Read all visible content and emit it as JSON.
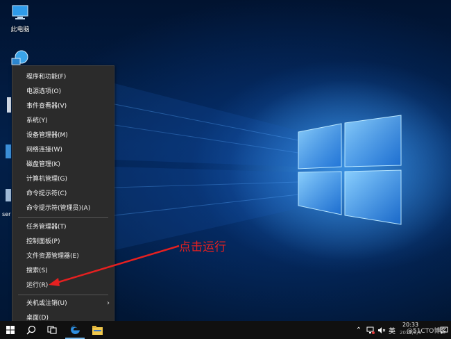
{
  "desktop": {
    "icons": [
      {
        "label": "此电脑",
        "icon": "this-pc-icon"
      },
      {
        "label": "",
        "icon": "network-icon"
      }
    ],
    "partial_labels": [
      "ser"
    ]
  },
  "context_menu": {
    "groups": [
      [
        "程序和功能(F)",
        "电源选项(O)",
        "事件查看器(V)",
        "系统(Y)",
        "设备管理器(M)",
        "网络连接(W)",
        "磁盘管理(K)",
        "计算机管理(G)",
        "命令提示符(C)",
        "命令提示符(管理员)(A)"
      ],
      [
        "任务管理器(T)",
        "控制面板(P)",
        "文件资源管理器(E)",
        "搜索(S)",
        "运行(R)"
      ],
      [
        "关机或注销(U)",
        "桌面(D)"
      ]
    ],
    "submenu_item": "关机或注销(U)",
    "highlighted_item": "运行(R)"
  },
  "annotation": {
    "text": "点击运行",
    "color": "#e62020"
  },
  "taskbar": {
    "ime": "英",
    "time": "20:33",
    "date": "2019/8/5",
    "watermark": "@51CTO博客",
    "icons": [
      "windows-start-icon",
      "search-icon",
      "task-view-icon",
      "edge-icon",
      "file-explorer-icon",
      "chevron-up-icon",
      "network-status-icon",
      "volume-muted-icon",
      "notification-icon"
    ]
  },
  "colors": {
    "menu_bg": "#2b2b2b",
    "taskbar_bg": "#101010",
    "accent": "#1e90ff"
  }
}
